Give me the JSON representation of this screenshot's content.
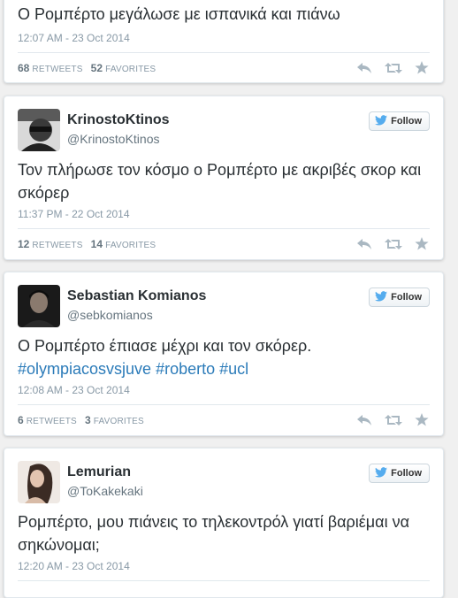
{
  "tweets": [
    {
      "text": "Ο Ρομπέρτο μεγάλωσε με ισπανικά και πιάνω",
      "time": "12:07 AM - 23 Oct 2014",
      "retweets": "68",
      "favorites": "52",
      "retweets_label": "RETWEETS",
      "favorites_label": "FAVORITES"
    },
    {
      "name": "KrinostoKtinos",
      "handle": "@KrinostoKtinos",
      "follow_label": "Follow",
      "text": "Τον πλήρωσε τον κόσμο ο Ρομπέρτο με ακριβές σκορ και σκόρερ",
      "time": "11:37 PM - 22 Oct 2014",
      "retweets": "12",
      "favorites": "14",
      "retweets_label": "RETWEETS",
      "favorites_label": "FAVORITES"
    },
    {
      "name": "Sebastian Komianos",
      "handle": "@sebkomianos",
      "follow_label": "Follow",
      "text": "Ο Ρομπέρτο έπιασε μέχρι και τον σκόρερ.",
      "hashtags": [
        "#olympiacosvsjuve",
        "#roberto",
        "#ucl"
      ],
      "time": "12:08 AM - 23 Oct 2014",
      "retweets": "6",
      "favorites": "3",
      "retweets_label": "RETWEETS",
      "favorites_label": "FAVORITES"
    },
    {
      "name": "Lemurian",
      "handle": "@ToKakekaki",
      "follow_label": "Follow",
      "text": "Ρομπέρτο, μου πιάνεις το τηλεκοντρόλ γιατί βαριέμαι να σηκώνομαι;",
      "time": "12:20 AM - 23 Oct 2014"
    }
  ],
  "colors": {
    "background": "#f0f0f0",
    "hashtag": "#2b7bb9",
    "twitter_bird": "#55acee",
    "muted": "#8899a6"
  },
  "icons": [
    "twitter-bird-icon",
    "reply-icon",
    "retweet-icon",
    "favorite-star-icon"
  ]
}
